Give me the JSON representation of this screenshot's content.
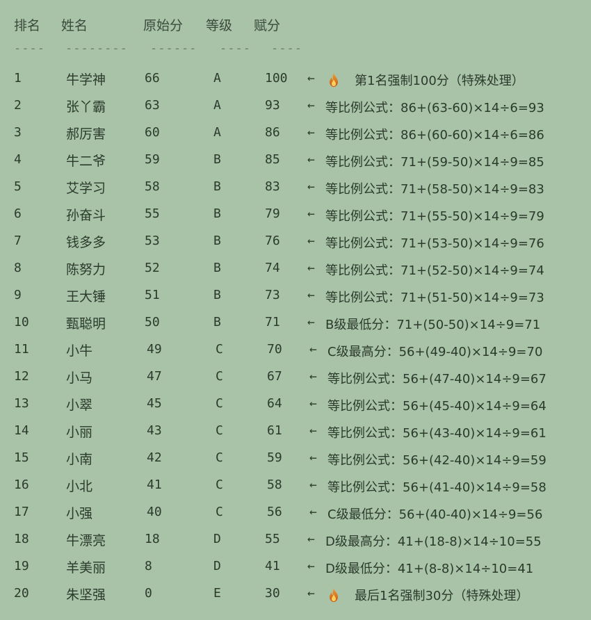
{
  "headers": {
    "rank": "排名",
    "name": "姓名",
    "raw": "原始分",
    "grade": "等级",
    "score": "赋分"
  },
  "separators": {
    "rank": "----",
    "name": "--------",
    "raw": "------",
    "grade": "----",
    "score": "----"
  },
  "arrow": "←",
  "rows": [
    {
      "rank": "1",
      "name": "牛学神",
      "raw": "66",
      "grade": "A",
      "score": "100",
      "icon": "fire-icon",
      "note": "第1名强制100分（特殊处理）"
    },
    {
      "rank": "2",
      "name": "张丫霸",
      "raw": "63",
      "grade": "A",
      "score": "93",
      "note": "等比例公式：86+(63-60)×14÷6=93"
    },
    {
      "rank": "3",
      "name": "郝厉害",
      "raw": "60",
      "grade": "A",
      "score": "86",
      "note": "等比例公式：86+(60-60)×14÷6=86"
    },
    {
      "rank": "4",
      "name": "牛二爷",
      "raw": "59",
      "grade": "B",
      "score": "85",
      "note": "等比例公式：71+(59-50)×14÷9=85"
    },
    {
      "rank": "5",
      "name": "艾学习",
      "raw": "58",
      "grade": "B",
      "score": "83",
      "note": "等比例公式：71+(58-50)×14÷9=83"
    },
    {
      "rank": "6",
      "name": "孙奋斗",
      "raw": "55",
      "grade": "B",
      "score": "79",
      "note": "等比例公式：71+(55-50)×14÷9=79"
    },
    {
      "rank": "7",
      "name": "钱多多",
      "raw": "53",
      "grade": "B",
      "score": "76",
      "note": "等比例公式：71+(53-50)×14÷9=76"
    },
    {
      "rank": "8",
      "name": "陈努力",
      "raw": "52",
      "grade": "B",
      "score": "74",
      "note": "等比例公式：71+(52-50)×14÷9=74"
    },
    {
      "rank": "9",
      "name": "王大锤",
      "raw": "51",
      "grade": "B",
      "score": "73",
      "note": "等比例公式：71+(51-50)×14÷9=73"
    },
    {
      "rank": "10",
      "name": "甄聪明",
      "raw": "50",
      "grade": "B",
      "score": "71",
      "note": "B级最低分：71+(50-50)×14÷9=71"
    },
    {
      "rank": "11",
      "name": "小牛",
      "raw": "49",
      "grade": "C",
      "score": "70",
      "note": "C级最高分：56+(49-40)×14÷9=70"
    },
    {
      "rank": "12",
      "name": "小马",
      "raw": "47",
      "grade": "C",
      "score": "67",
      "note": "等比例公式：56+(47-40)×14÷9=67"
    },
    {
      "rank": "13",
      "name": "小翠",
      "raw": "45",
      "grade": "C",
      "score": "64",
      "note": "等比例公式：56+(45-40)×14÷9=64"
    },
    {
      "rank": "14",
      "name": "小丽",
      "raw": "43",
      "grade": "C",
      "score": "61",
      "note": "等比例公式：56+(43-40)×14÷9=61"
    },
    {
      "rank": "15",
      "name": "小南",
      "raw": "42",
      "grade": "C",
      "score": "59",
      "note": "等比例公式：56+(42-40)×14÷9=59"
    },
    {
      "rank": "16",
      "name": "小北",
      "raw": "41",
      "grade": "C",
      "score": "58",
      "note": "等比例公式：56+(41-40)×14÷9=58"
    },
    {
      "rank": "17",
      "name": "小强",
      "raw": "40",
      "grade": "C",
      "score": "56",
      "note": "C级最低分：56+(40-40)×14÷9=56"
    },
    {
      "rank": "18",
      "name": "牛漂亮",
      "raw": "18",
      "grade": "D",
      "score": "55",
      "note": "D级最高分：41+(18-8)×14÷10=55"
    },
    {
      "rank": "19",
      "name": "羊美丽",
      "raw": "8",
      "grade": "D",
      "score": "41",
      "note": "D级最低分：41+(8-8)×14÷10=41"
    },
    {
      "rank": "20",
      "name": "朱坚强",
      "raw": "0",
      "grade": "E",
      "score": "30",
      "icon": "fire-icon",
      "note": "最后1名强制30分（特殊处理）"
    }
  ]
}
